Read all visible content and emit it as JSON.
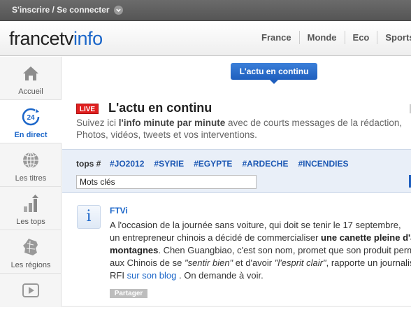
{
  "topbar": {
    "login_label": "S'inscrire / Se connecter",
    "chevron_icon": "chevron-down-icon"
  },
  "header": {
    "logo_part1": "francetv",
    "logo_part2": "info",
    "nav": [
      "France",
      "Monde",
      "Eco",
      "Sports"
    ]
  },
  "sidebar": {
    "items": [
      {
        "label": "Accueil",
        "icon": "home-icon"
      },
      {
        "label": "En direct",
        "icon": "live-24-icon",
        "active": true
      },
      {
        "label": "Les titres",
        "icon": "globe-icon"
      },
      {
        "label": "Les tops",
        "icon": "bar-chart-icon"
      },
      {
        "label": "Les régions",
        "icon": "france-map-icon"
      },
      {
        "label": "",
        "icon": "video-play-icon"
      }
    ]
  },
  "main": {
    "tab_label": "L'actu en continu",
    "live_badge": "LIVE",
    "title": "L'actu en continu",
    "intro_pre": "Suivez ici ",
    "intro_bold": "l'info minute par minute",
    "intro_post": " avec de courts messages de la rédaction,",
    "intro_line2": "Photos, vidéos, tweets et vos interventions.",
    "tops": {
      "label": "tops #",
      "tags": [
        "#JO2012",
        "#SYRIE",
        "#EGYPTE",
        "#ARDECHE",
        "#INCENDIES"
      ],
      "search_placeholder": "Mots clés"
    },
    "post": {
      "author": "FTVi",
      "line1": "A l'occasion de la journée sans voiture, qui doit se tenir le 17 septembre,",
      "line2_pre": "un entrepreneur chinois a décidé de commercialiser ",
      "line2_bold": "une canette pleine d'air de",
      "line3_bold": "montagnes",
      "line3_post": ". Chen Guangbiao, c'est son nom, promet que son produit permettra",
      "line4_pre": "aux Chinois de se ",
      "line4_i1": "\"sentir bien\"",
      "line4_mid": " et d'avoir ",
      "line4_i2": "\"l'esprit clair\"",
      "line4_post": ", rapporte un journaliste",
      "line5_pre": "RFI ",
      "line5_link": "sur son blog",
      "line5_post": " . On demande à voir.",
      "share_label": "Partager"
    }
  },
  "colors": {
    "brand_blue": "#1b66c9",
    "live_red": "#e02020",
    "tops_bg": "#e9eff8"
  }
}
